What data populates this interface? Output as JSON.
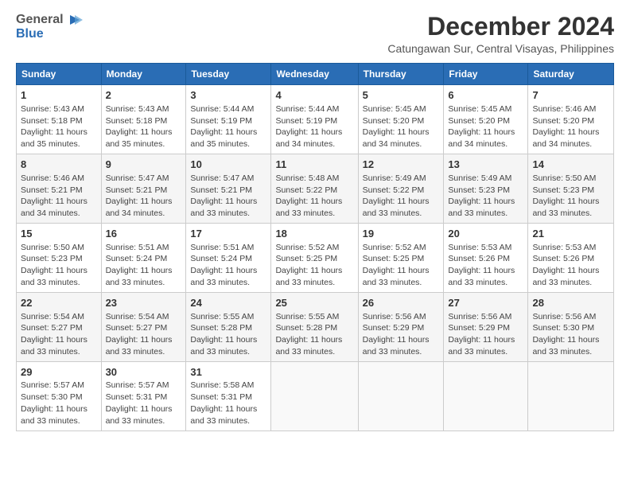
{
  "logo": {
    "general": "General",
    "blue": "Blue"
  },
  "title": "December 2024",
  "location": "Catungawan Sur, Central Visayas, Philippines",
  "days_of_week": [
    "Sunday",
    "Monday",
    "Tuesday",
    "Wednesday",
    "Thursday",
    "Friday",
    "Saturday"
  ],
  "weeks": [
    [
      {
        "day": "1",
        "sunrise": "5:43 AM",
        "sunset": "5:18 PM",
        "daylight": "11 hours and 35 minutes."
      },
      {
        "day": "2",
        "sunrise": "5:43 AM",
        "sunset": "5:18 PM",
        "daylight": "11 hours and 35 minutes."
      },
      {
        "day": "3",
        "sunrise": "5:44 AM",
        "sunset": "5:19 PM",
        "daylight": "11 hours and 35 minutes."
      },
      {
        "day": "4",
        "sunrise": "5:44 AM",
        "sunset": "5:19 PM",
        "daylight": "11 hours and 34 minutes."
      },
      {
        "day": "5",
        "sunrise": "5:45 AM",
        "sunset": "5:20 PM",
        "daylight": "11 hours and 34 minutes."
      },
      {
        "day": "6",
        "sunrise": "5:45 AM",
        "sunset": "5:20 PM",
        "daylight": "11 hours and 34 minutes."
      },
      {
        "day": "7",
        "sunrise": "5:46 AM",
        "sunset": "5:20 PM",
        "daylight": "11 hours and 34 minutes."
      }
    ],
    [
      {
        "day": "8",
        "sunrise": "5:46 AM",
        "sunset": "5:21 PM",
        "daylight": "11 hours and 34 minutes."
      },
      {
        "day": "9",
        "sunrise": "5:47 AM",
        "sunset": "5:21 PM",
        "daylight": "11 hours and 34 minutes."
      },
      {
        "day": "10",
        "sunrise": "5:47 AM",
        "sunset": "5:21 PM",
        "daylight": "11 hours and 33 minutes."
      },
      {
        "day": "11",
        "sunrise": "5:48 AM",
        "sunset": "5:22 PM",
        "daylight": "11 hours and 33 minutes."
      },
      {
        "day": "12",
        "sunrise": "5:49 AM",
        "sunset": "5:22 PM",
        "daylight": "11 hours and 33 minutes."
      },
      {
        "day": "13",
        "sunrise": "5:49 AM",
        "sunset": "5:23 PM",
        "daylight": "11 hours and 33 minutes."
      },
      {
        "day": "14",
        "sunrise": "5:50 AM",
        "sunset": "5:23 PM",
        "daylight": "11 hours and 33 minutes."
      }
    ],
    [
      {
        "day": "15",
        "sunrise": "5:50 AM",
        "sunset": "5:23 PM",
        "daylight": "11 hours and 33 minutes."
      },
      {
        "day": "16",
        "sunrise": "5:51 AM",
        "sunset": "5:24 PM",
        "daylight": "11 hours and 33 minutes."
      },
      {
        "day": "17",
        "sunrise": "5:51 AM",
        "sunset": "5:24 PM",
        "daylight": "11 hours and 33 minutes."
      },
      {
        "day": "18",
        "sunrise": "5:52 AM",
        "sunset": "5:25 PM",
        "daylight": "11 hours and 33 minutes."
      },
      {
        "day": "19",
        "sunrise": "5:52 AM",
        "sunset": "5:25 PM",
        "daylight": "11 hours and 33 minutes."
      },
      {
        "day": "20",
        "sunrise": "5:53 AM",
        "sunset": "5:26 PM",
        "daylight": "11 hours and 33 minutes."
      },
      {
        "day": "21",
        "sunrise": "5:53 AM",
        "sunset": "5:26 PM",
        "daylight": "11 hours and 33 minutes."
      }
    ],
    [
      {
        "day": "22",
        "sunrise": "5:54 AM",
        "sunset": "5:27 PM",
        "daylight": "11 hours and 33 minutes."
      },
      {
        "day": "23",
        "sunrise": "5:54 AM",
        "sunset": "5:27 PM",
        "daylight": "11 hours and 33 minutes."
      },
      {
        "day": "24",
        "sunrise": "5:55 AM",
        "sunset": "5:28 PM",
        "daylight": "11 hours and 33 minutes."
      },
      {
        "day": "25",
        "sunrise": "5:55 AM",
        "sunset": "5:28 PM",
        "daylight": "11 hours and 33 minutes."
      },
      {
        "day": "26",
        "sunrise": "5:56 AM",
        "sunset": "5:29 PM",
        "daylight": "11 hours and 33 minutes."
      },
      {
        "day": "27",
        "sunrise": "5:56 AM",
        "sunset": "5:29 PM",
        "daylight": "11 hours and 33 minutes."
      },
      {
        "day": "28",
        "sunrise": "5:56 AM",
        "sunset": "5:30 PM",
        "daylight": "11 hours and 33 minutes."
      }
    ],
    [
      {
        "day": "29",
        "sunrise": "5:57 AM",
        "sunset": "5:30 PM",
        "daylight": "11 hours and 33 minutes."
      },
      {
        "day": "30",
        "sunrise": "5:57 AM",
        "sunset": "5:31 PM",
        "daylight": "11 hours and 33 minutes."
      },
      {
        "day": "31",
        "sunrise": "5:58 AM",
        "sunset": "5:31 PM",
        "daylight": "11 hours and 33 minutes."
      },
      null,
      null,
      null,
      null
    ]
  ],
  "labels": {
    "sunrise": "Sunrise:",
    "sunset": "Sunset:",
    "daylight": "Daylight:"
  }
}
